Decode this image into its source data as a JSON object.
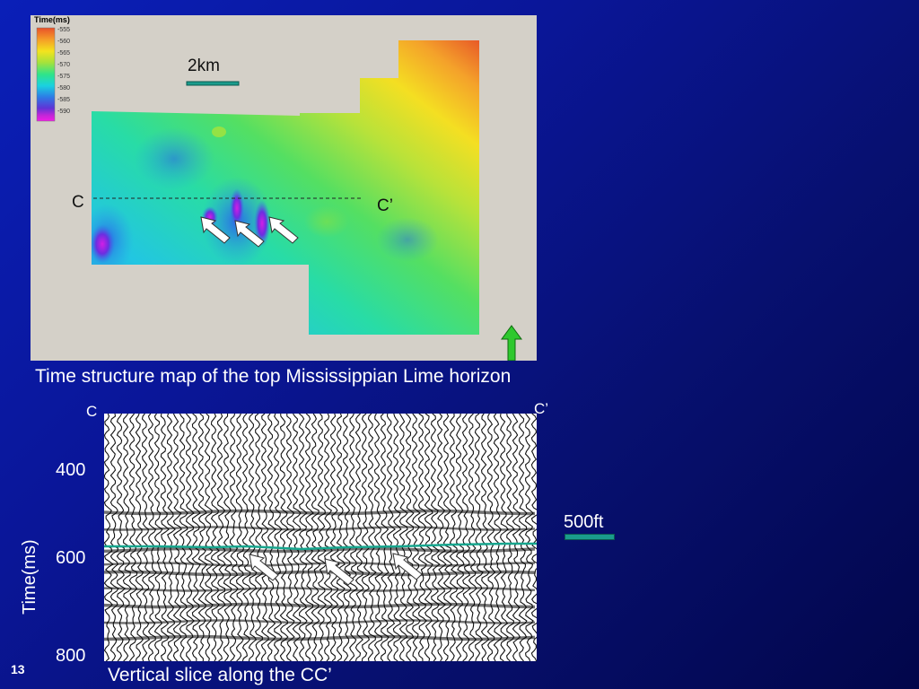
{
  "map": {
    "legend_title": "Time(ms)",
    "legend_ticks": [
      "-555",
      "-560",
      "-565",
      "-570",
      "-575",
      "-580",
      "-585",
      "-590"
    ],
    "legend_colors": [
      "#e8502a",
      "#f59a28",
      "#f4e31e",
      "#a7e23a",
      "#2ee48a",
      "#1ad2e0",
      "#2c7de6",
      "#5f34d6",
      "#c426d8",
      "#f21ee6"
    ],
    "scale_label": "2km",
    "label_c": "C",
    "label_c_prime": "C’"
  },
  "caption_map": "Time structure map of the top Mississippian Lime horizon",
  "seismic": {
    "label_c": "C",
    "label_c_prime": "C’",
    "y_ticks": [
      "400",
      "600",
      "800"
    ],
    "y_axis_label": "Time(ms)",
    "scale_label": "500ft",
    "horizon_color": "#17a68e"
  },
  "caption_slice": "Vertical slice along the CC’",
  "slide_number": "13"
}
